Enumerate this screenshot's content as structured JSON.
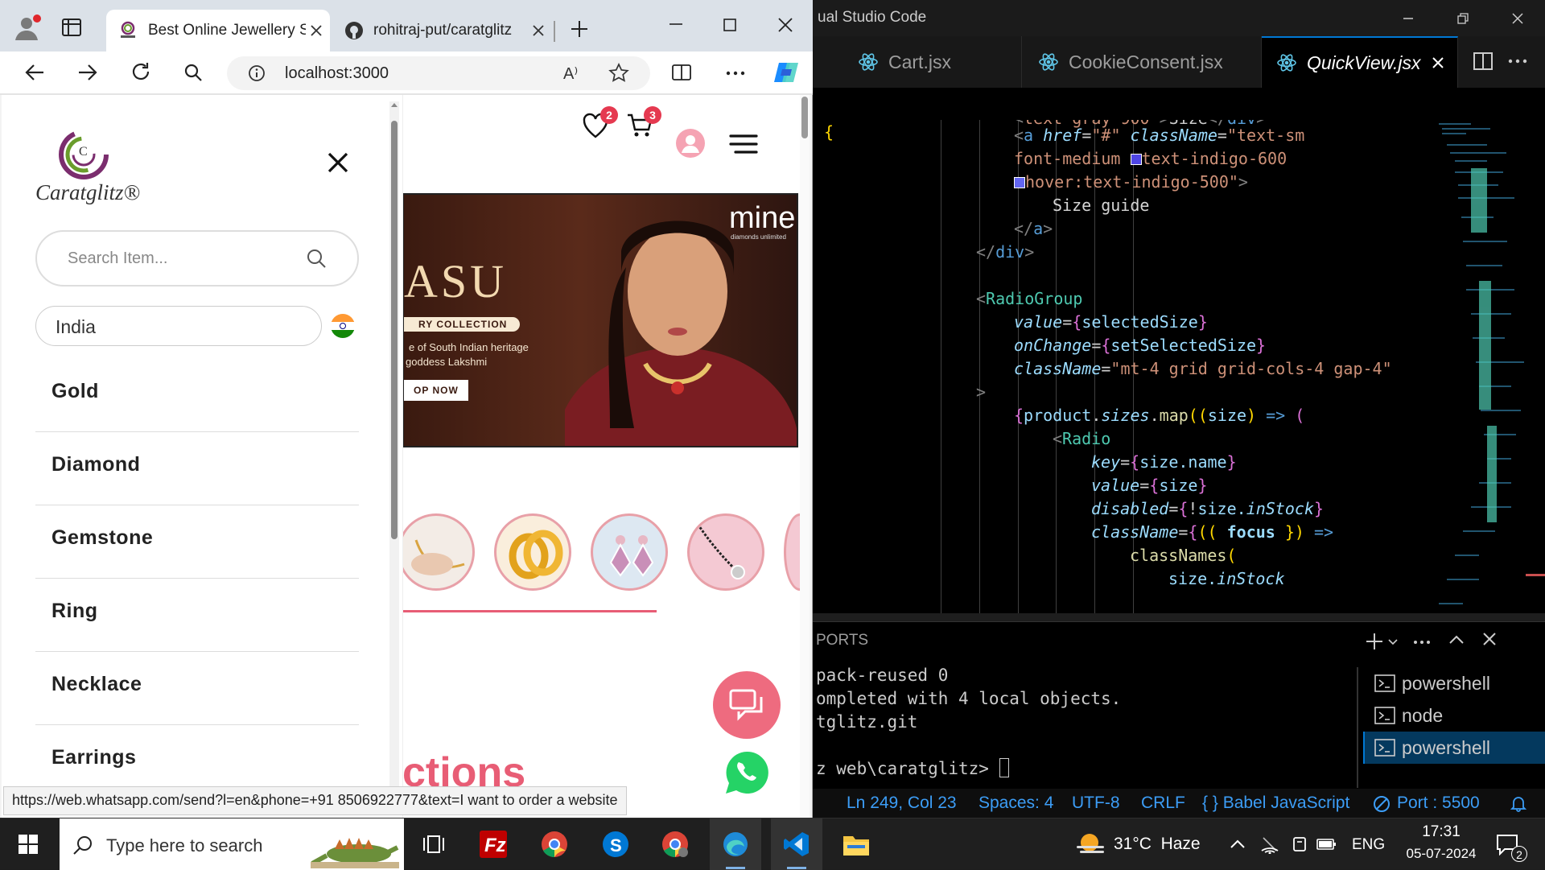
{
  "edge": {
    "tabs": [
      {
        "title": "Best Online Jewellery S",
        "active": true
      },
      {
        "title": "rohitraj-put/caratglitz",
        "active": false
      }
    ],
    "address": "localhost:3000",
    "read_aloud_label": "A⁾",
    "status_url": "https://web.whatsapp.com/send?l=en&phone=+91 8506922777&text=I want to order a website"
  },
  "site": {
    "logo_text": "Caratglitz®",
    "logo_letter": "C",
    "search_placeholder": "Search Item...",
    "country": "India",
    "categories": [
      "Gold",
      "Diamond",
      "Gemstone",
      "Ring",
      "Necklace",
      "Earrings"
    ],
    "wishlist_count": "2",
    "cart_count": "3",
    "banner": {
      "brand": "mine",
      "brand_sub": "diamonds unlimited",
      "title_fragment": "ASU",
      "collection": "RY COLLECTION",
      "line1": "e of South Indian heritage",
      "line2": "goddess Lakshmi",
      "cta": "OP NOW"
    },
    "section_heading_fragment": "ctions"
  },
  "vscode": {
    "title": "ual Studio Code",
    "tabs": [
      "Cart.jsx",
      "CookieConsent.jsx",
      "QuickView.jsx"
    ],
    "panel_label": "PORTS",
    "terminal_lines": [
      "pack-reused 0",
      "ompleted with 4 local objects.",
      "tglitz.git",
      "",
      "z web\\caratglitz> "
    ],
    "terminals": [
      "powershell",
      "node",
      "powershell"
    ],
    "status": {
      "position": "Ln 249, Col 23",
      "spaces": "Spaces: 4",
      "encoding": "UTF-8",
      "eol": "CRLF",
      "language": "{ } Babel JavaScript",
      "port": "Port : 5500"
    }
  },
  "taskbar": {
    "search_placeholder": "Type here to search",
    "weather": "31°C  Haze",
    "language": "ENG",
    "time": "17:31",
    "date": "05-07-2024",
    "notifications": "2"
  },
  "colors": {
    "accent_pink": "#e85d75",
    "vscode_blue": "#0078d4",
    "badge_red": "#e53950"
  }
}
